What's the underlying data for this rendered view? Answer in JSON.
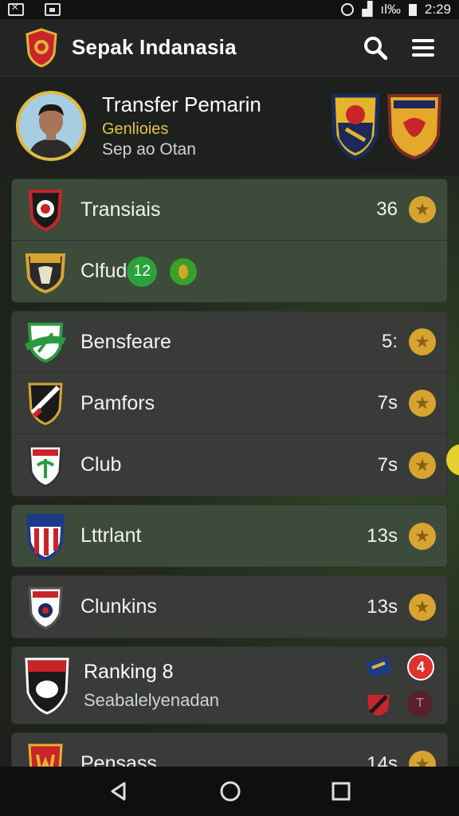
{
  "status_bar": {
    "battery": "ıl‰",
    "time": "2:29"
  },
  "app_bar": {
    "title": "Sepak Indanasia",
    "icons": [
      "search-icon",
      "menu-icon"
    ]
  },
  "hero": {
    "title": "Transfer Pemarin",
    "subtitle": "Genlioies",
    "caption": "Sep ao Otan"
  },
  "cards": [
    {
      "style": "green",
      "rows": [
        {
          "label": "Transiais",
          "value": "36",
          "badge": "coin"
        },
        {
          "label": "Clfud",
          "value": "12",
          "badge": "green-dot"
        }
      ]
    },
    {
      "style": "dark",
      "rows": [
        {
          "label": "Bensfeare",
          "value": "5:",
          "badge": "coin"
        },
        {
          "label": "Pamfors",
          "value": "7s",
          "badge": "coin"
        },
        {
          "label": "Club",
          "value": "7s",
          "badge": "coin"
        }
      ]
    },
    {
      "style": "green",
      "rows": [
        {
          "label": "Lttrlant",
          "value": "13s",
          "badge": "coin"
        }
      ]
    },
    {
      "style": "dark",
      "rows": [
        {
          "label": "Clunkins",
          "value": "13s",
          "badge": "coin"
        }
      ]
    }
  ],
  "ranking": {
    "title": "Ranking 8",
    "subtitle": "Seabalelyenadan",
    "badge": "4",
    "minor": "T"
  },
  "last_row": {
    "label": "Pensass",
    "value": "14s"
  },
  "colors": {
    "accent_gold": "#d7a431",
    "green": "#2aa33a",
    "red": "#e0312c"
  }
}
